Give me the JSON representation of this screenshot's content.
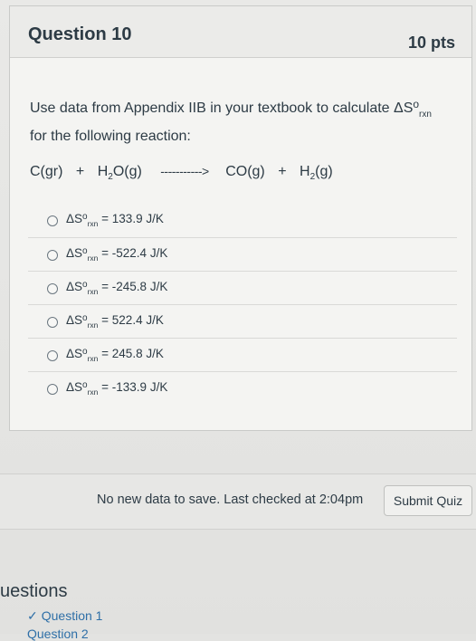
{
  "question": {
    "title": "Question 10",
    "points": "10 pts",
    "prompt_line1": "Use data from Appendix IIB in your textbook to calculate ",
    "prompt_delta": "ΔS",
    "prompt_deg": "o",
    "prompt_sub": "rxn",
    "prompt_line2": "for the following reaction:",
    "equation": {
      "reactant1": "C(gr)",
      "plus1": "+",
      "reactant2_pre": "H",
      "reactant2_sub": "2",
      "reactant2_post": "O(g)",
      "arrow": "----------->",
      "product1": "CO(g)",
      "plus2": "+",
      "product2_pre": "H",
      "product2_sub": "2",
      "product2_post": "(g)"
    },
    "answer_prefix": "ΔS",
    "answer_deg": "o",
    "answer_sub": "rxn",
    "answers": [
      {
        "value": " = 133.9 J/K"
      },
      {
        "value": " = -522.4 J/K"
      },
      {
        "value": " = -245.8 J/K"
      },
      {
        "value": " = 522.4 J/K"
      },
      {
        "value": " = 245.8 J/K"
      },
      {
        "value": " = -133.9 J/K"
      }
    ]
  },
  "footer": {
    "status": "No new data to save. Last checked at 2:04pm",
    "submit_label": "Submit Quiz"
  },
  "nav": {
    "heading": "uestions",
    "item1_check": "✓",
    "item1": "Question 1",
    "item2": "Question 2"
  }
}
